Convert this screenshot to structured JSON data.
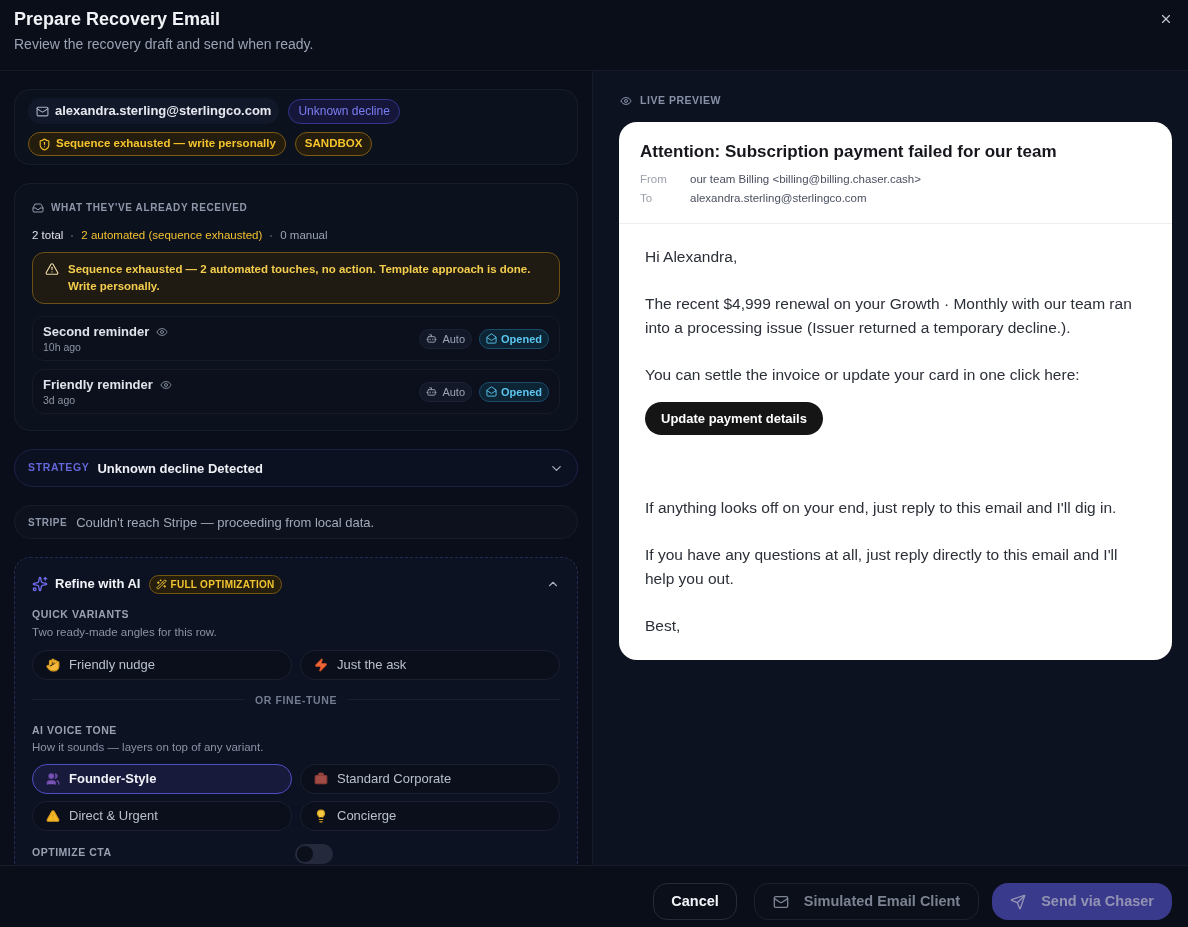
{
  "dialog": {
    "title": "Prepare Recovery Email",
    "subtitle": "Review the recovery draft and send when ready."
  },
  "contact": {
    "email": "alexandra.sterling@sterlingco.com",
    "decline_tag": "Unknown decline",
    "flags": [
      {
        "label": "Sequence exhausted — write personally",
        "kind": "warning"
      },
      {
        "label": "SANDBOX",
        "kind": "sandbox"
      }
    ]
  },
  "history": {
    "title": "WHAT THEY'VE ALREADY RECEIVED",
    "stats": [
      {
        "text": "2 total",
        "kind": "total"
      },
      {
        "text": "2 automated (sequence exhausted)",
        "kind": "automated"
      },
      {
        "text": "0 manual",
        "kind": "manual"
      }
    ],
    "alert": "Sequence exhausted — 2 automated touches, no action. Template approach is done. Write personally.",
    "items": [
      {
        "title": "Second reminder",
        "time": "10h ago",
        "source": "Auto",
        "status": "Opened"
      },
      {
        "title": "Friendly reminder",
        "time": "3d ago",
        "source": "Auto",
        "status": "Opened"
      }
    ]
  },
  "strategy": {
    "label": "STRATEGY",
    "value": "Unknown decline Detected",
    "expanded": false
  },
  "stripe": {
    "label": "STRIPE",
    "message": "Couldn't reach Stripe — proceeding from local data."
  },
  "refine": {
    "title": "Refine with AI",
    "badge": "FULL OPTIMIZATION",
    "expanded": true,
    "quick_variants": {
      "label": "QUICK VARIANTS",
      "hint": "Two ready-made angles for this row.",
      "options": [
        {
          "label": "Friendly nudge",
          "selected": false
        },
        {
          "label": "Just the ask",
          "selected": false
        }
      ]
    },
    "divider": "OR FINE-TUNE",
    "voice_tone": {
      "label": "AI VOICE TONE",
      "hint": "How it sounds — layers on top of any variant.",
      "options": [
        {
          "label": "Founder-Style",
          "selected": true
        },
        {
          "label": "Standard Corporate",
          "selected": false
        },
        {
          "label": "Direct & Urgent",
          "selected": false
        },
        {
          "label": "Concierge",
          "selected": false
        }
      ]
    },
    "optimize_cta": {
      "label": "OPTIMIZE CTA",
      "on": false
    }
  },
  "preview": {
    "label": "LIVE PREVIEW",
    "subject": "Attention: Subscription payment failed for our team",
    "from_label": "From",
    "from": "our team Billing <billing@billing.chaser.cash>",
    "to_label": "To",
    "to": "alexandra.sterling@sterlingco.com",
    "body": [
      {
        "kind": "paragraph",
        "text": "Hi Alexandra,"
      },
      {
        "kind": "paragraph",
        "text": "The recent $4,999 renewal on your Growth · Monthly with our team ran into a processing issue (Issuer returned a temporary decline.)."
      },
      {
        "kind": "paragraph",
        "text": "You can settle the invoice or update your card in one click here:"
      },
      {
        "kind": "button",
        "text": "Update payment details"
      },
      {
        "kind": "paragraph",
        "text": "If anything looks off on your end, just reply to this email and I'll dig in."
      },
      {
        "kind": "paragraph",
        "text": "If you have any questions at all, just reply directly to this email and I'll help you out."
      },
      {
        "kind": "paragraph",
        "text": "Best,"
      }
    ]
  },
  "footer": {
    "buttons": [
      {
        "label": "Cancel",
        "kind": "secondary",
        "disabled": false
      },
      {
        "label": "Simulated Email Client",
        "kind": "client",
        "disabled": true
      },
      {
        "label": "Send via Chaser",
        "kind": "primary",
        "disabled": true
      }
    ]
  }
}
